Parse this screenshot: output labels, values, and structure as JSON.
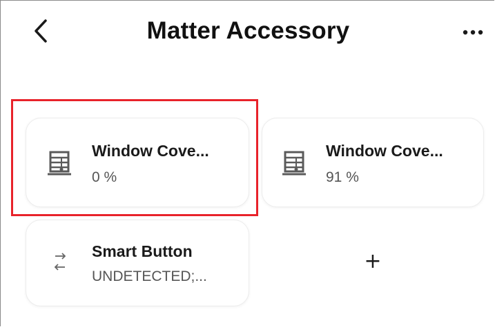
{
  "header": {
    "title": "Matter Accessory",
    "back_icon": "chevron-left-icon",
    "more_icon": "more-horizontal-icon"
  },
  "devices": [
    {
      "name": "Window Cove...",
      "status": "0 %",
      "icon": "window-covering-icon",
      "selected": true
    },
    {
      "name": "Window Cove...",
      "status": "91 %",
      "icon": "window-covering-icon",
      "selected": false
    },
    {
      "name": "Smart Button",
      "status": "UNDETECTED;...",
      "icon": "swap-arrows-icon",
      "selected": false
    }
  ],
  "add_tile": {
    "label": "+"
  },
  "colors": {
    "highlight": "#e8222a",
    "icon": "#5a5a5a",
    "text": "#1a1a1a",
    "subtext": "#555555"
  }
}
